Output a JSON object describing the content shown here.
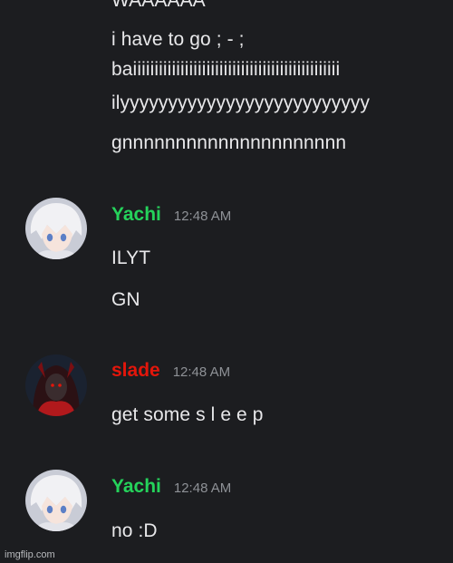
{
  "colors": {
    "background": "#1c1d20",
    "message_text": "#e8e8ea",
    "timestamp": "#8e9196",
    "yachi_name": "#25d35b",
    "slade_name": "#e3160b"
  },
  "chat": {
    "preceding_lines": {
      "cut_off_line": "WAAAAAA",
      "lines": [
        "i have to go ; - ;",
        "baiiiiiiiiiiiiiiiiiiiiiiiiiiiiiiiiiiiiiiiiiiiiiiii",
        "ilyyyyyyyyyyyyyyyyyyyyyyyyyy",
        "gnnnnnnnnnnnnnnnnnnnnn"
      ]
    },
    "messages": [
      {
        "author": "Yachi",
        "author_color": "#25d35b",
        "avatar_icon": "anime-avatar-white-hair-icon",
        "timestamp": "12:48 AM",
        "lines": [
          "ILYT",
          "GN"
        ]
      },
      {
        "author": "slade",
        "author_color": "#e3160b",
        "avatar_icon": "dark-avatar-red-icon",
        "timestamp": "12:48 AM",
        "lines": [
          "get some s l e e p"
        ]
      },
      {
        "author": "Yachi",
        "author_color": "#25d35b",
        "avatar_icon": "anime-avatar-white-hair-icon",
        "timestamp": "12:48 AM",
        "lines": [
          "no :D"
        ]
      }
    ]
  },
  "watermark": "imgflip.com"
}
